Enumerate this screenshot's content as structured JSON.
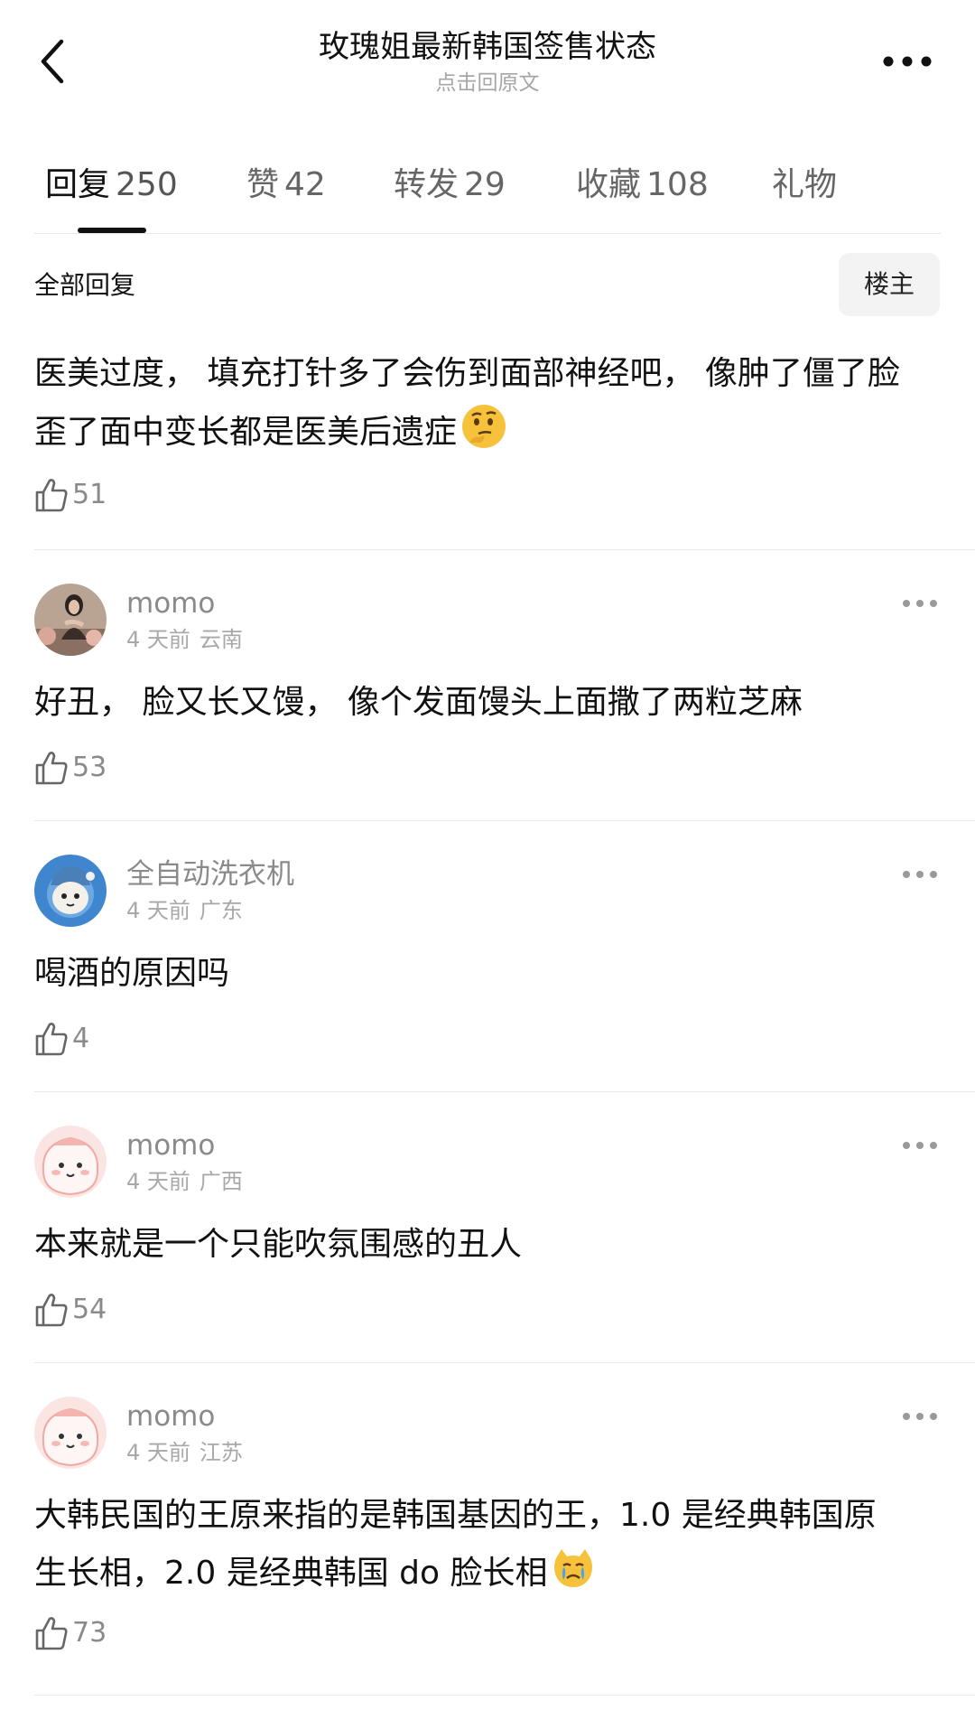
{
  "header": {
    "title": "玫瑰姐最新韩国签售状态",
    "subtitle": "点击回原文",
    "back_icon": "chevron-left-icon",
    "more_icon": "more-horizontal-icon"
  },
  "tabs": [
    {
      "label": "回复",
      "count": "250",
      "active": true
    },
    {
      "label": "赞",
      "count": "42",
      "active": false
    },
    {
      "label": "转发",
      "count": "29",
      "active": false
    },
    {
      "label": "收藏",
      "count": "108",
      "active": false
    },
    {
      "label": "礼物",
      "count": "",
      "active": false
    }
  ],
  "sort": {
    "label": "全部回复",
    "op_button": "楼主"
  },
  "op_comment": {
    "text_line1": "医美过度， 填充打针多了会伤到面部神经吧， 像肿了僵了脸",
    "text_line2": "歪了面中变长都是医美后遗症",
    "emoji": "thinking-face-emoji",
    "likes": "51"
  },
  "comments": [
    {
      "username": "momo",
      "time": "4 天前",
      "location": "云南",
      "text": "好丑， 脸又长又馒， 像个发面馒头上面撒了两粒芝麻",
      "likes": "53",
      "avatar": "photo-avatar"
    },
    {
      "username": "全自动洗衣机",
      "time": "4 天前",
      "location": "广东",
      "text": "喝酒的原因吗",
      "likes": "4",
      "avatar": "cartoon-blue-avatar"
    },
    {
      "username": "momo",
      "time": "4 天前",
      "location": "广西",
      "text": "本来就是一个只能吹氛围感的丑人",
      "likes": "54",
      "avatar": "pink-blob-avatar"
    },
    {
      "username": "momo",
      "time": "4 天前",
      "location": "江苏",
      "text_line1": "大韩民国的王原来指的是韩国基因的王，1.0 是经典韩国原",
      "text_line2": "生长相，2.0 是经典韩国 do 脸长相",
      "emoji": "crying-cat-emoji",
      "likes": "73",
      "avatar": "pink-blob-avatar"
    }
  ],
  "colors": {
    "primary_text": "#111111",
    "secondary_text": "#8a8a8a",
    "meta_text": "#a8a8a8",
    "divider": "#e9e9e9",
    "op_badge_bg": "#f3f3f3"
  }
}
